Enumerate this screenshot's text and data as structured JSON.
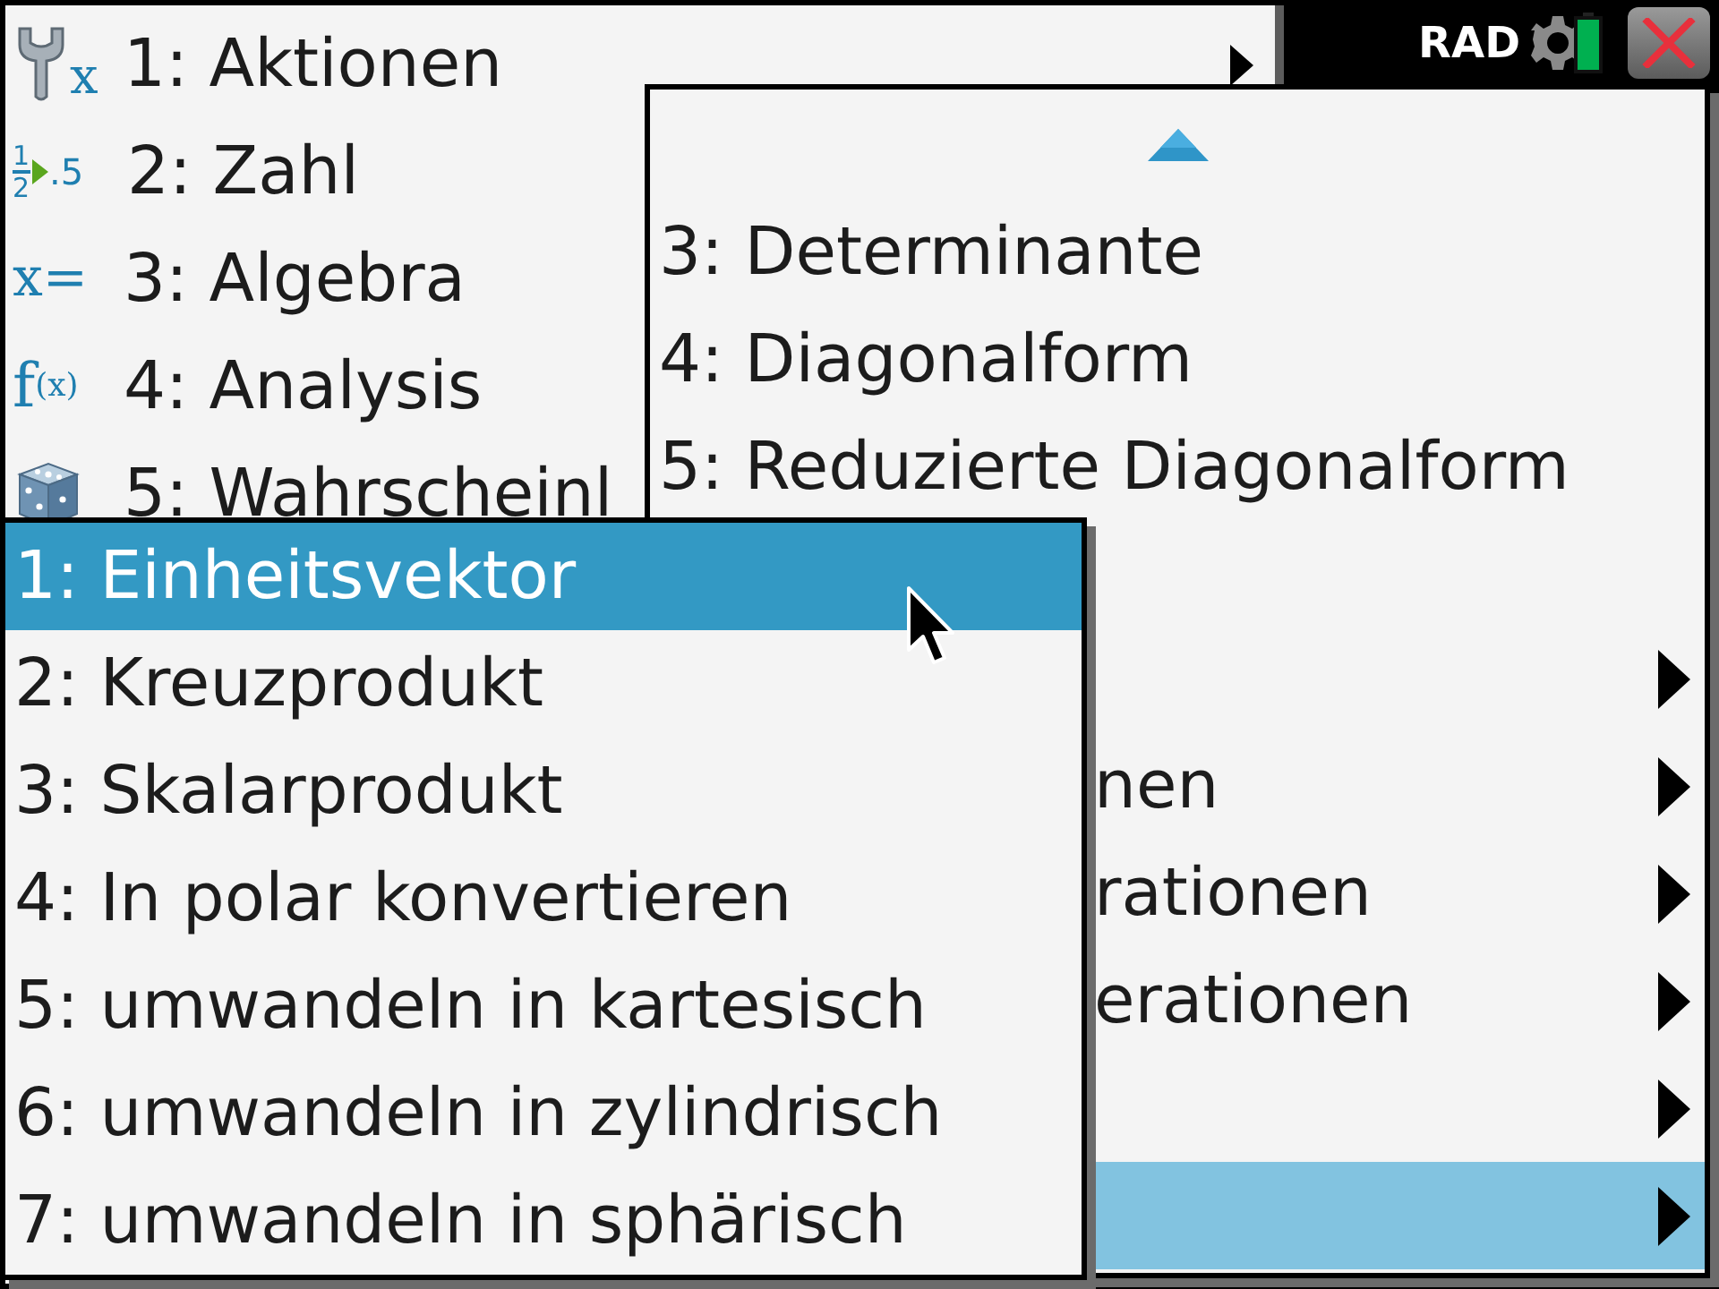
{
  "status_bar": {
    "angle_mode": "RAD"
  },
  "menus": [
    {
      "items": [
        {
          "label": "1: Aktionen",
          "icon": {
            "kind": "wrench",
            "glyphs": [
              "x"
            ]
          },
          "submenu": true,
          "selected": false
        },
        {
          "label": "2: Zahl",
          "icon": {
            "kind": "fraction",
            "glyphs": [
              "1",
              "2",
              ".5"
            ]
          },
          "selected": false
        },
        {
          "label": "3: Algebra",
          "icon": {
            "kind": "equation",
            "glyphs": [
              "x="
            ]
          },
          "selected": false
        },
        {
          "label": "4: Analysis",
          "icon": {
            "kind": "function",
            "glyphs": [
              "f",
              "(x)"
            ]
          },
          "selected": false
        },
        {
          "label": "5: Wahrscheinl",
          "icon": {
            "kind": "dice"
          },
          "selected": false
        }
      ]
    },
    {
      "scroll_up": true,
      "items": [
        {
          "label": "3: Determinante",
          "submenu": false,
          "selected": false
        },
        {
          "label": "4: Diagonalform",
          "submenu": false,
          "selected": false
        },
        {
          "label": "5: Reduzierte Diagonalform",
          "submenu": false,
          "selected": false
        },
        {
          "submenu": true,
          "selected": false
        },
        {
          "label": "nen",
          "submenu": true,
          "selected": false
        },
        {
          "label": "rationen",
          "submenu": true,
          "selected": false
        },
        {
          "label": "erationen",
          "submenu": true,
          "selected": false
        },
        {
          "submenu": true,
          "selected": false
        },
        {
          "submenu": true,
          "selected": true
        }
      ]
    },
    {
      "items": [
        {
          "label": "1: Einheitsvektor",
          "submenu": false,
          "selected": true
        },
        {
          "label": "2: Kreuzprodukt",
          "submenu": false,
          "selected": false
        },
        {
          "label": "3: Skalarprodukt",
          "submenu": false,
          "selected": false
        },
        {
          "label": "4: In polar konvertieren",
          "submenu": false,
          "selected": false
        },
        {
          "label": "5: umwandeln in kartesisch",
          "submenu": false,
          "selected": false
        },
        {
          "label": "6: umwandeln in zylindrisch",
          "submenu": false,
          "selected": false
        },
        {
          "label": "7: umwandeln in sphärisch",
          "submenu": false,
          "selected": false
        }
      ]
    }
  ]
}
